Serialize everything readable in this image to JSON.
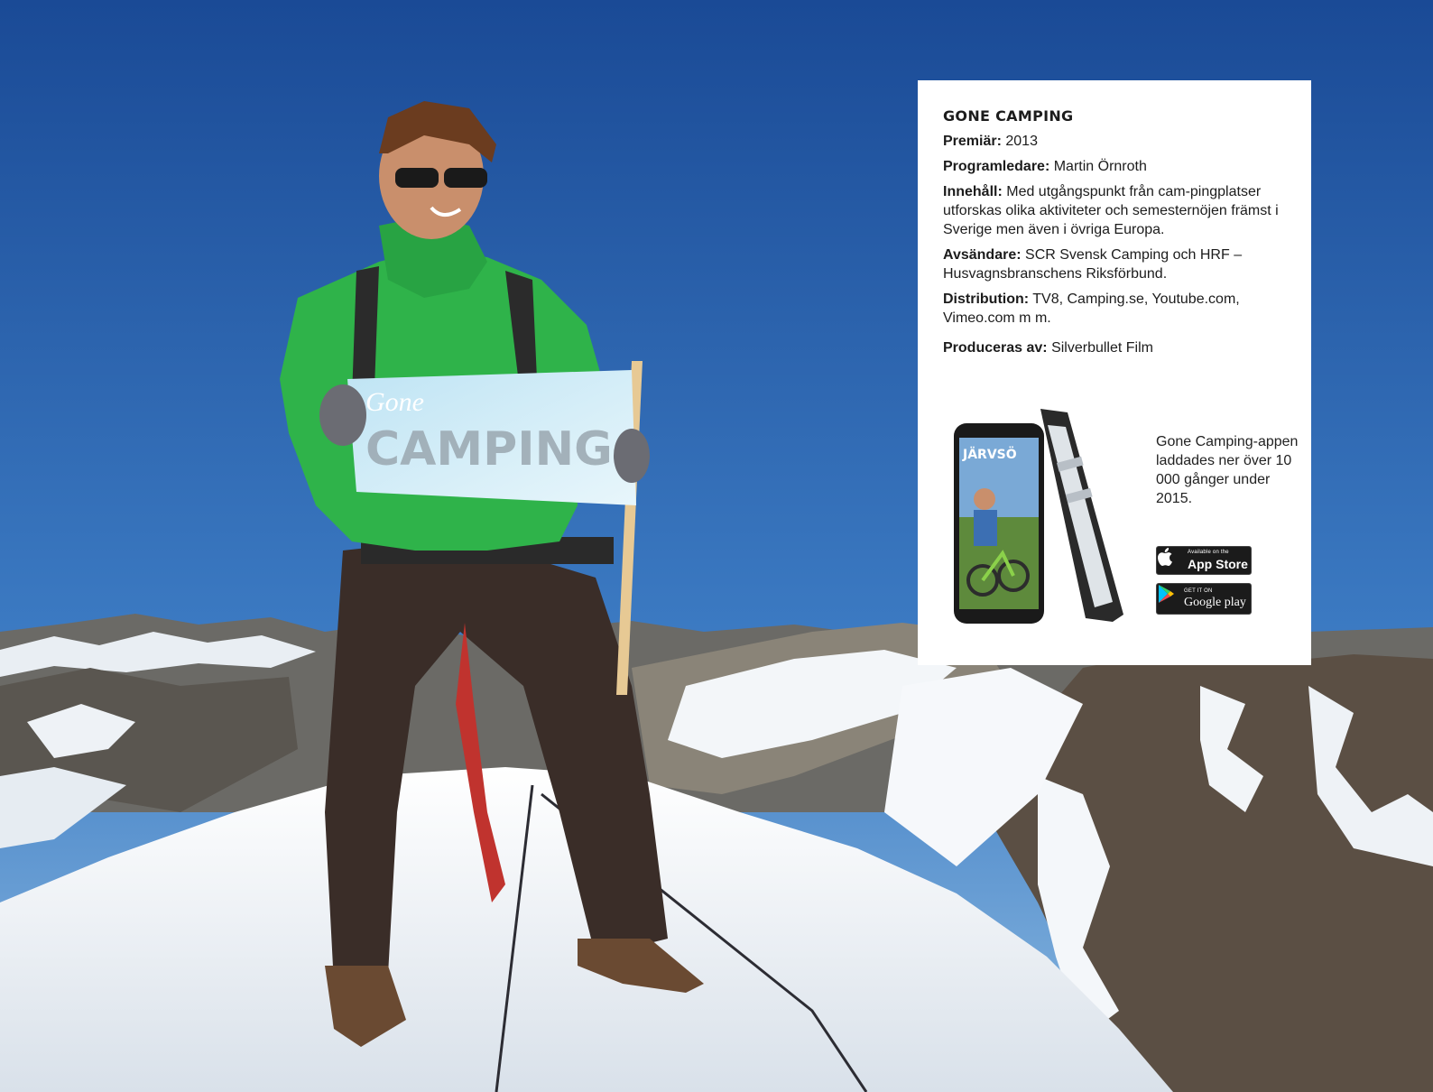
{
  "card": {
    "title": "GONE CAMPING",
    "premiere_label": "Premiär:",
    "premiere_value": "2013",
    "host_label": "Programledare:",
    "host_value": "Martin Örnroth",
    "content_label": "Innehåll:",
    "content_value": "Med utgångspunkt från cam-pingplatser utforskas olika aktiviteter och semesternöjen främst i Sverige men även i övriga Europa.",
    "sender_label": "Avsändare:",
    "sender_value": "SCR Svensk Camping och HRF – Husvagnsbranschens Riksförbund.",
    "distribution_label": "Distribution:",
    "distribution_value": "TV8, Camping.se, Youtube.com, Vimeo.com m m.",
    "producer_label": "Produceras av:",
    "producer_value": "Silverbullet Film"
  },
  "promo": {
    "text": "Gone Camping-appen laddades ner över 10 000 gånger under 2015.",
    "phone_screen_title": "JÄRVSÖ",
    "appstore_small": "Available on the",
    "appstore_big": "App Store",
    "googleplay_small": "GET IT ON",
    "googleplay_big": "Google play"
  },
  "flag": {
    "line1": "Gone",
    "line2": "CAMPING"
  },
  "colors": {
    "sky_top": "#1d4f9c",
    "sky_bottom": "#6fa6d8",
    "jacket": "#2fb34a",
    "snow": "#f1f4f8"
  }
}
